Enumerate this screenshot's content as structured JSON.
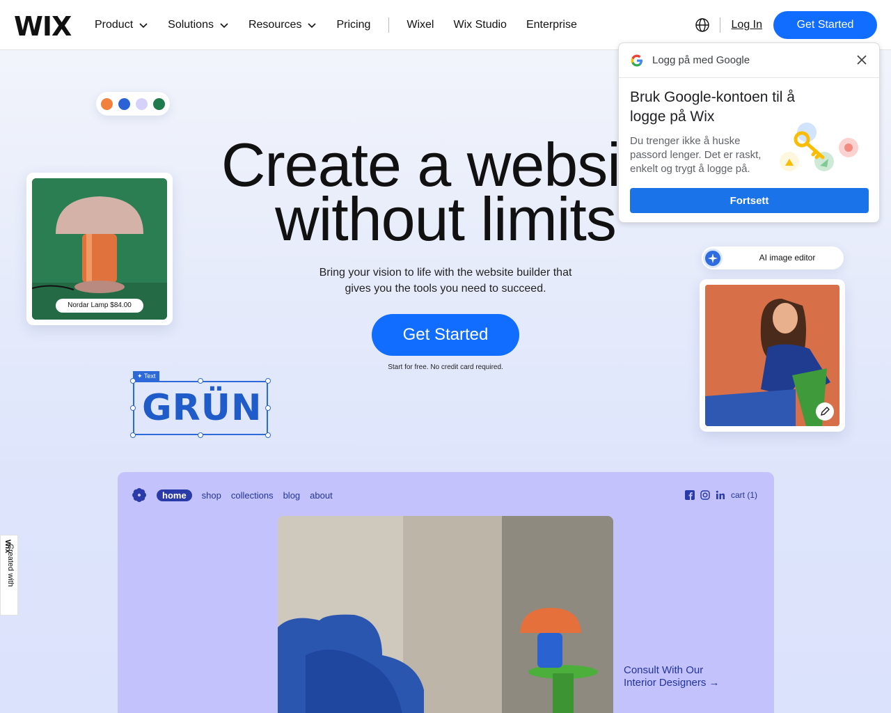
{
  "header": {
    "logo": "WIX",
    "nav": [
      {
        "label": "Product",
        "has_menu": true
      },
      {
        "label": "Solutions",
        "has_menu": true
      },
      {
        "label": "Resources",
        "has_menu": true
      },
      {
        "label": "Pricing",
        "has_menu": false
      }
    ],
    "nav_secondary": [
      "Wixel",
      "Wix Studio",
      "Enterprise"
    ],
    "login": "Log In",
    "cta": "Get Started"
  },
  "hero": {
    "title_line1": "Create a website",
    "title_line2": "without limits",
    "subtitle_line1": "Bring your vision to life with the website builder that",
    "subtitle_line2": "gives you the tools you need to succeed.",
    "cta": "Get Started",
    "note": "Start for free. No credit card required.",
    "palette_colors": [
      "#f3813e",
      "#2b63d6",
      "#d6d1fb",
      "#1f7a4d"
    ]
  },
  "lamp_card": {
    "tag": "Nordar Lamp $84.00"
  },
  "text_element": {
    "label": "Text",
    "wordmark": "GRÜN"
  },
  "ai_editor": {
    "label": "AI image editor"
  },
  "google_popup": {
    "header": "Logg på med Google",
    "title": "Bruk Google-kontoen til å logge på Wix",
    "description": "Du trenger ikke å huske passord lenger. Det er raskt, enkelt og trygt å logge på.",
    "button": "Fortsett"
  },
  "site_preview": {
    "nav": [
      "home",
      "shop",
      "collections",
      "blog",
      "about"
    ],
    "cart": "cart (1)",
    "consult_line1": "Consult With Our",
    "consult_line2": "Interior Designers →",
    "accent": "#c4c2fd"
  },
  "badge": {
    "text": "Created with ",
    "brand": "Wix"
  }
}
